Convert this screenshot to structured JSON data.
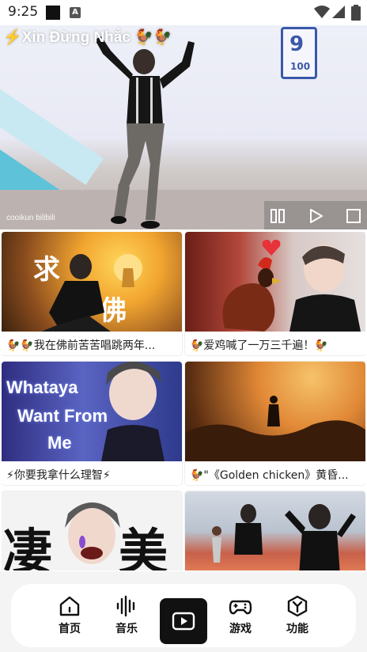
{
  "status_bar": {
    "time": "9:25",
    "icons": [
      "notification-square-icon",
      "a-badge-icon",
      "wifi-icon",
      "signal-icon",
      "battery-icon"
    ]
  },
  "player": {
    "title": "⚡Xin Đừng Nhắc 🐓🐓",
    "watermark": "cooikun bilibili",
    "controls": [
      "pause-icon",
      "play-icon",
      "stop-icon"
    ]
  },
  "videos": [
    {
      "caption": "🐓🐓我在佛前苦苦唱跳两年...",
      "overlay": "求 佛"
    },
    {
      "caption": "🐓爱鸡喊了一万三千遍！🐓",
      "overlay": ""
    },
    {
      "caption": "⚡你要我拿什么理智⚡",
      "overlay": "Whataya Want From Me"
    },
    {
      "caption": "🐓\"《Golden chicken》黄昏...",
      "overlay": ""
    },
    {
      "caption": "",
      "overlay": "凄 美"
    },
    {
      "caption": "",
      "overlay": ""
    }
  ],
  "nav": {
    "items": [
      {
        "label": "首页",
        "icon": "home-icon"
      },
      {
        "label": "音乐",
        "icon": "waveform-icon"
      },
      {
        "label": "",
        "icon": "video-play-icon",
        "active": true
      },
      {
        "label": "游戏",
        "icon": "gamepad-icon"
      },
      {
        "label": "功能",
        "icon": "hexagon-y-icon"
      }
    ]
  },
  "colors": {
    "accent_dark": "#111111",
    "nav_background": "#f4f4f4",
    "stripe_cyan": "#5ec3d9",
    "logo_blue": "#3a58a8"
  }
}
